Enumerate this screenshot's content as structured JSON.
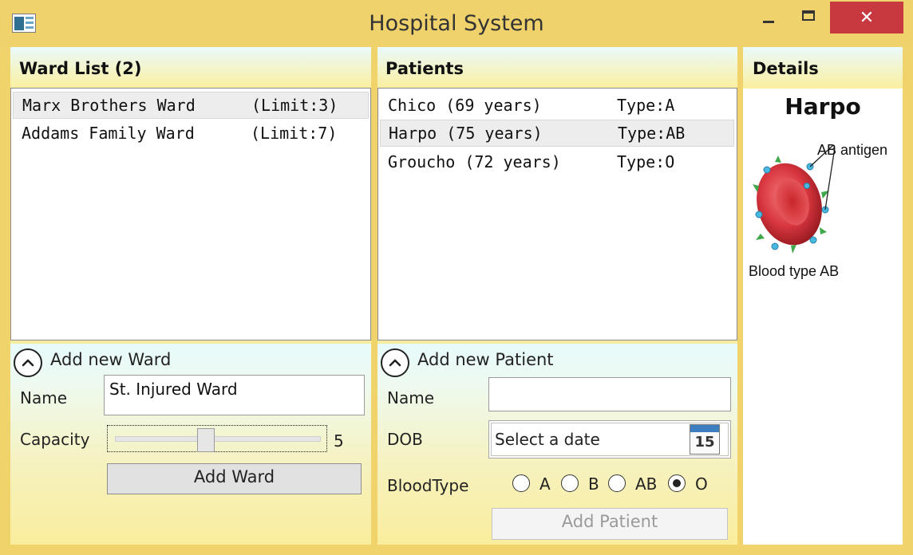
{
  "window": {
    "title": "Hospital System",
    "close_glyph": "✕"
  },
  "ward_panel": {
    "header": "Ward List (2)",
    "items": [
      {
        "name": "Marx Brothers Ward",
        "limit": "(Limit:3)"
      },
      {
        "name": "Addams Family Ward",
        "limit": "(Limit:7)"
      }
    ],
    "expander_label": "Add new Ward",
    "name_label": "Name",
    "name_value": "St. Injured Ward",
    "capacity_label": "Capacity",
    "capacity_value": "5",
    "capacity_range": [
      1,
      10
    ],
    "add_button": "Add Ward"
  },
  "patient_panel": {
    "header": "Patients",
    "items": [
      {
        "name": "Chico (69 years)",
        "type": "Type:A"
      },
      {
        "name": "Harpo (75 years)",
        "type": "Type:AB"
      },
      {
        "name": "Groucho (72 years)",
        "type": "Type:O"
      }
    ],
    "expander_label": "Add new Patient",
    "name_label": "Name",
    "name_value": "",
    "dob_label": "DOB",
    "dob_placeholder": "Select a date",
    "calendar_day": "15",
    "bloodtype_label": "BloodType",
    "blood_options": [
      "A",
      "B",
      "AB",
      "O"
    ],
    "blood_selected": "O",
    "add_button": "Add Patient"
  },
  "details_panel": {
    "header": "Details",
    "name": "Harpo",
    "antigen_label": "AB antigen",
    "caption": "Blood type AB"
  },
  "colors": {
    "titlebar": "#efd26c",
    "close": "#c7393e",
    "panel_gradient_top": "#e8f9f9",
    "panel_gradient_bottom": "#f8ed9e"
  },
  "icons": [
    "app-icon",
    "minimize-icon",
    "maximize-icon",
    "close-icon",
    "collapse-chevron-icon",
    "calendar-icon"
  ]
}
